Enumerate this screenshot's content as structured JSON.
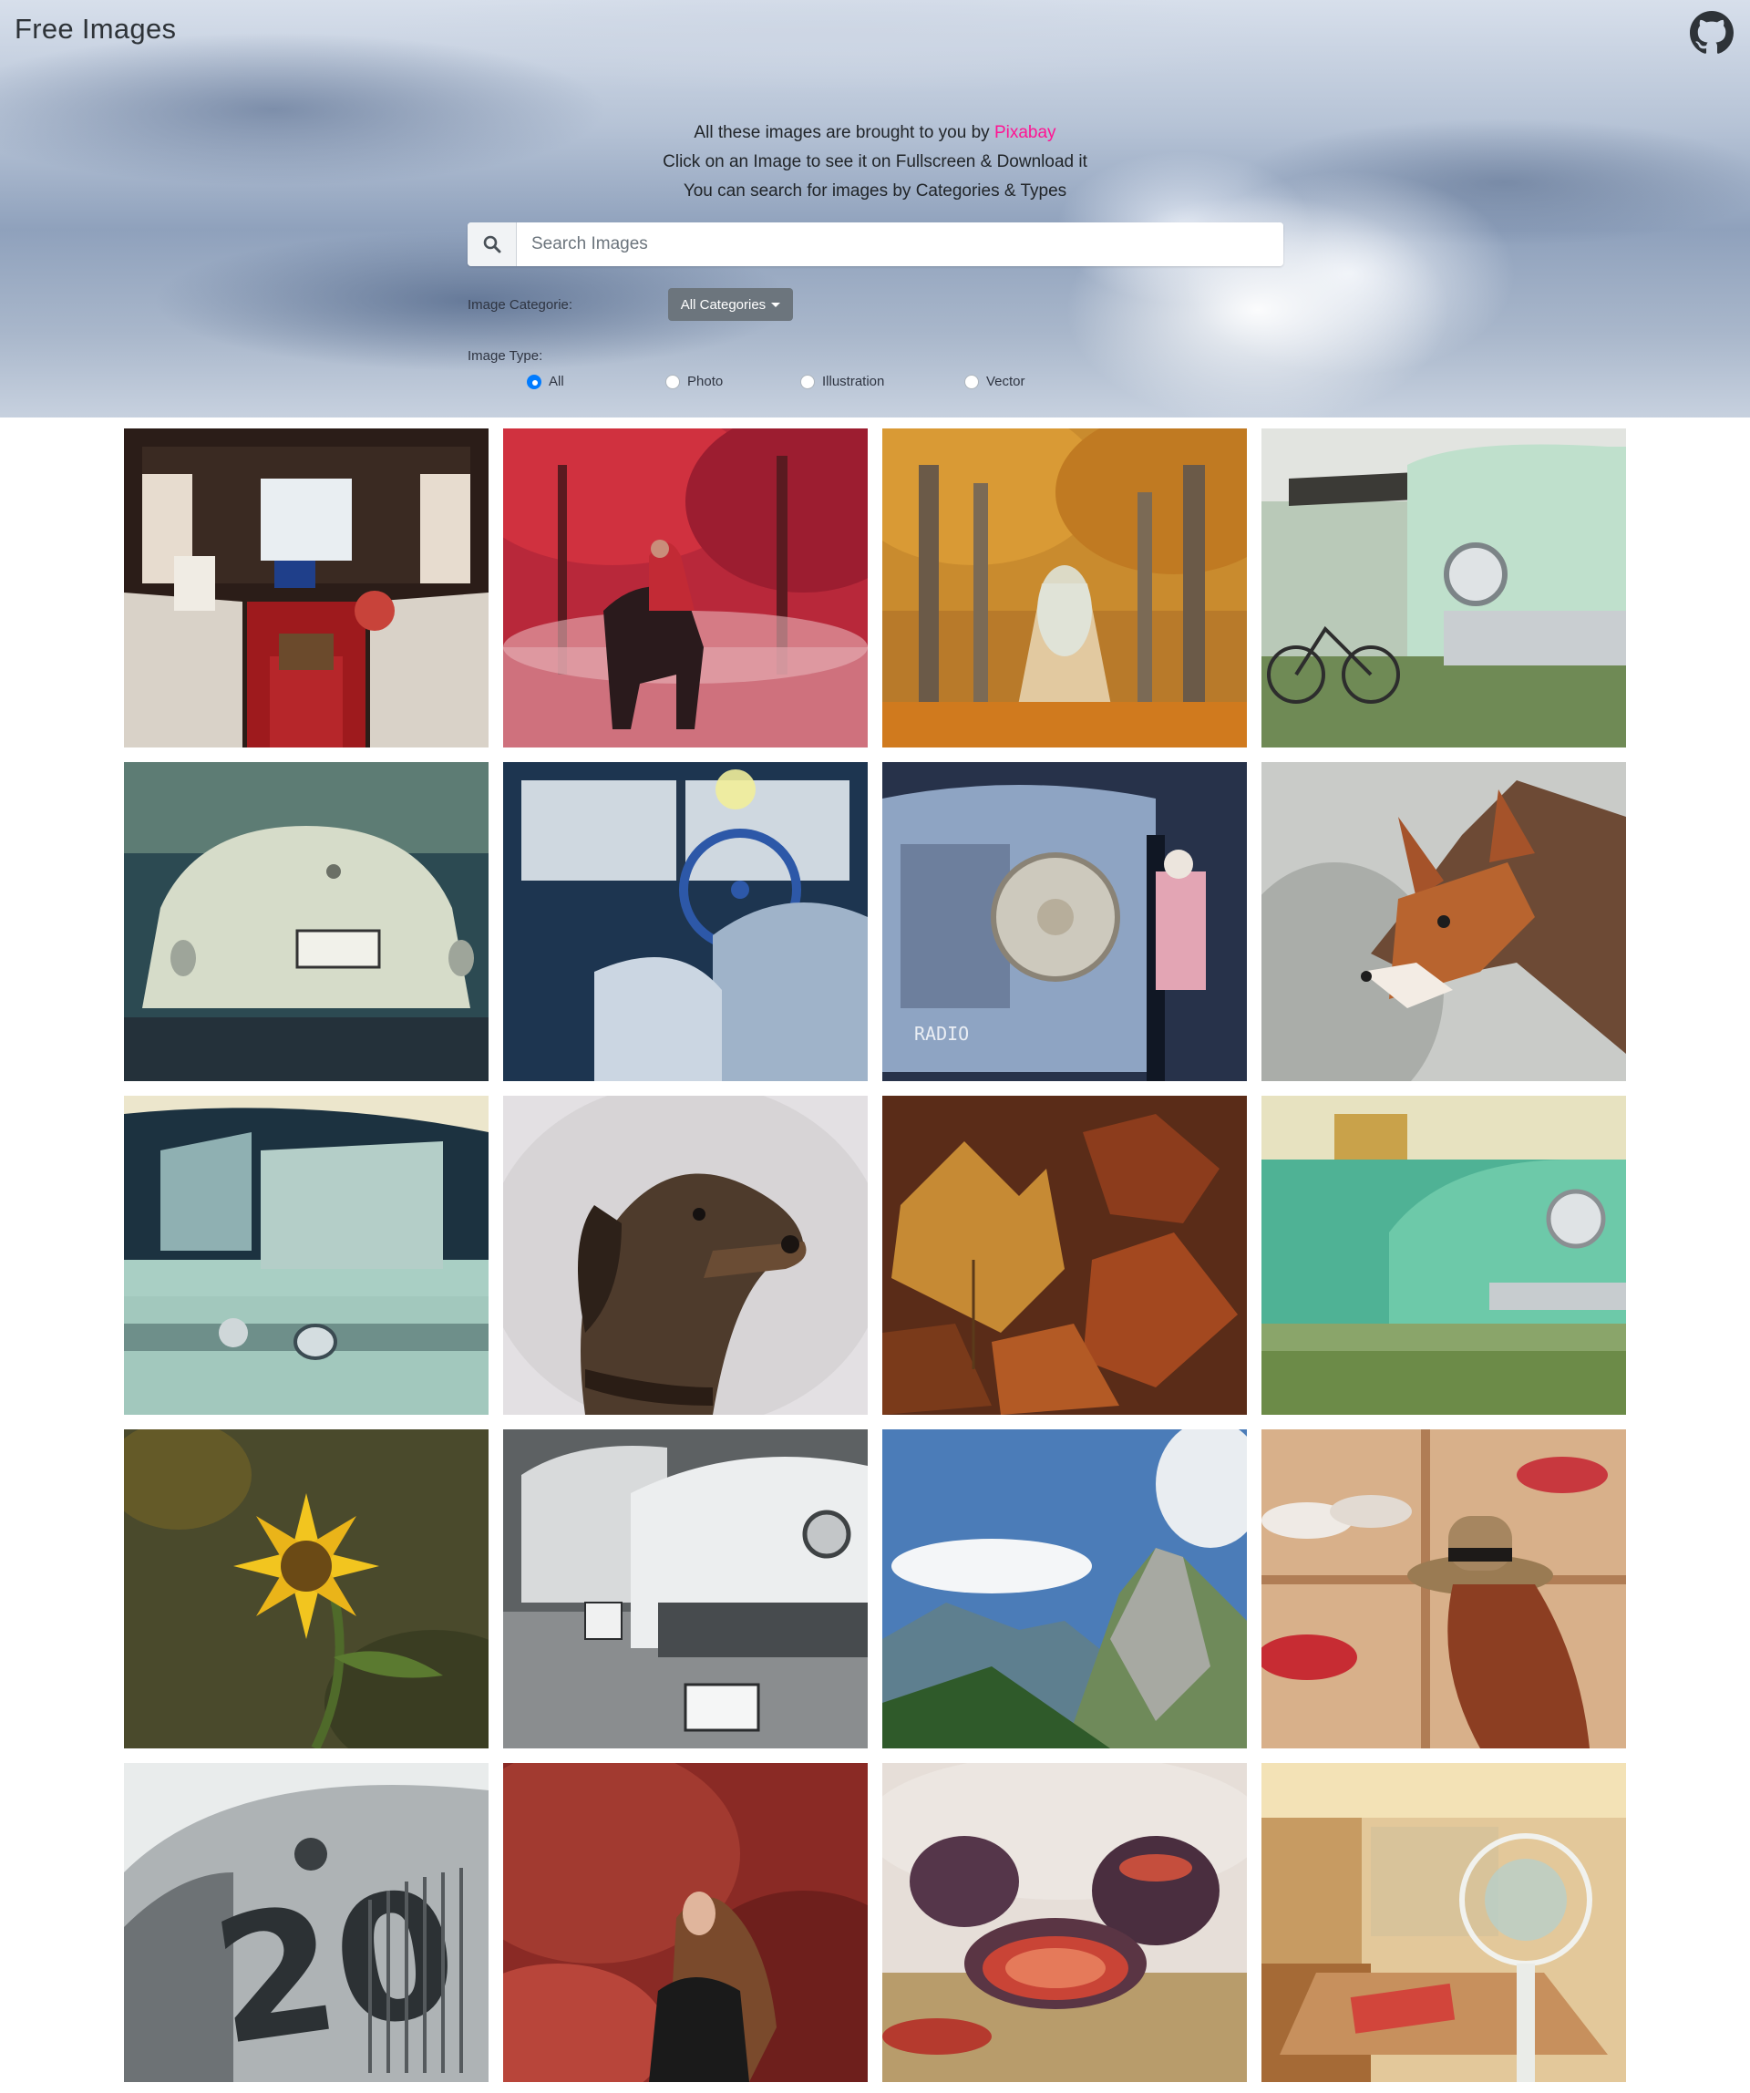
{
  "header": {
    "brand": "Free Images",
    "github_icon": "github-icon"
  },
  "intro": {
    "line1_prefix": "All these images are brought to you by ",
    "line1_link": "Pixabay",
    "line2": "Click on an Image to see it on Fullscreen & Download it",
    "line3": "You can search for images by Categories & Types"
  },
  "search": {
    "placeholder": "Search Images",
    "value": "",
    "icon": "search-icon"
  },
  "filters": {
    "category_label": "Image Categorie:",
    "category_button": "All Categories",
    "type_label": "Image Type:",
    "types": [
      "All",
      "Photo",
      "Illustration",
      "Vector"
    ],
    "selected_type": "All"
  },
  "colors": {
    "link": "#ff1493",
    "category_button": "#6c757d",
    "radio_selected": "#007bff"
  },
  "images": [
    {
      "subject": "gypsy-caravan-interior"
    },
    {
      "subject": "woman-on-horse-red-forest"
    },
    {
      "subject": "autumn-tree-avenue"
    },
    {
      "subject": "vintage-car-and-bicycle"
    },
    {
      "subject": "vintage-convertible-rear"
    },
    {
      "subject": "van-interior-steering-wheel"
    },
    {
      "subject": "retro-radio-queen-figure"
    },
    {
      "subject": "fox-portrait"
    },
    {
      "subject": "vintage-car-window"
    },
    {
      "subject": "dachshund-portrait"
    },
    {
      "subject": "autumn-leaves"
    },
    {
      "subject": "green-cadillac-caravan"
    },
    {
      "subject": "sunflower"
    },
    {
      "subject": "vintage-cars-black-white"
    },
    {
      "subject": "mountain-landscape"
    },
    {
      "subject": "woman-with-hat"
    },
    {
      "subject": "race-car-number-20"
    },
    {
      "subject": "woman-red-foliage"
    },
    {
      "subject": "figs"
    },
    {
      "subject": "caravan-interior-fan"
    }
  ]
}
